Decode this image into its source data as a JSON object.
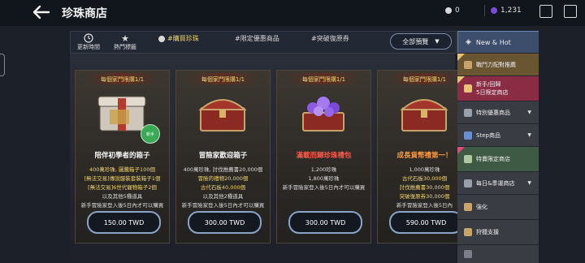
{
  "header": {
    "title": "珍珠商店"
  },
  "currencies": [
    {
      "icon": "white-pearl-icon",
      "value": "0",
      "color": "#d9d9d9"
    },
    {
      "icon": "purple-pearl-icon",
      "value": "1,231",
      "color": "#7b4ad8"
    }
  ],
  "nav": {
    "refresh_label": "更新時間",
    "popular_label": "熱門標籤",
    "filters": [
      "#購買珍珠",
      "#限定優惠商品",
      "#突破復原券"
    ],
    "all_button": "全部預覽"
  },
  "cards": [
    {
      "limit": "每個家門限購1/1",
      "title": "陪伴初學者的箱子",
      "lines": [
        "400萬珍珠, 圖騰箱子100個",
        "[無法交易]傳說服裝套裝箱子1個",
        "[無法交易]6世代寵物箱子2個",
        "以及其他5種道具",
        "新手冒險家登入後5日內才可以購買"
      ],
      "price": "150.00 TWD",
      "badge": "新手"
    },
    {
      "limit": "每個家門限購1/1",
      "title": "冒險家歡迎箱子",
      "lines": [
        "400萬珍珠, 討伐推薦書20,000個",
        "冒險的禮物20,000個",
        "古代石板40,000個",
        "以及其他2種道具",
        "新手冒險家登入後5日內才可以購買"
      ],
      "price": "300.00 TWD"
    },
    {
      "limit": "每個家門限購1/1",
      "title": "滿載而歸珍珠禮包",
      "lines": [
        "1,200珍珠",
        "1,800萬珍珠",
        "新手冒險家登入後5日內才可以購買"
      ],
      "price": "300.00 TWD"
    },
    {
      "limit": "每個家門限購1/1",
      "title": "成長貨幣禮第一！",
      "lines": [
        "1,000萬珍珠",
        "古代石板30,000個",
        "討伐推薦書30,000個",
        "突破復原券30,000個",
        "新手冒險家登入後5日內"
      ],
      "price": "590.00 TWD"
    }
  ],
  "sidebar": {
    "new_hot": "New & Hot",
    "items": [
      {
        "label": "戰鬥力配對推薦",
        "icon": "sword-icon",
        "color": "#6a5532"
      },
      {
        "label": "新手/回歸",
        "label2": "5日限定商店",
        "icon": "gift-icon",
        "color": "#8a2d44"
      },
      {
        "label": "特別優惠商品",
        "icon": "star-icon",
        "color": "#3a3c44",
        "arrow": "▼"
      },
      {
        "label": "Step商品",
        "icon": "step-icon",
        "color": "#3a3c44",
        "arrow": "▼"
      },
      {
        "label": "特賣限定商店",
        "icon": "sale-icon",
        "color": "#3f5a44"
      },
      {
        "label": "每日&季運商店",
        "icon": "calendar-icon",
        "color": "#3a3c44",
        "arrow": "▼"
      },
      {
        "label": "強化",
        "icon": "upgrade-icon",
        "color": "#3a3c44"
      },
      {
        "label": "狩獵支援",
        "icon": "hunt-icon",
        "color": "#3a3c44"
      }
    ]
  }
}
